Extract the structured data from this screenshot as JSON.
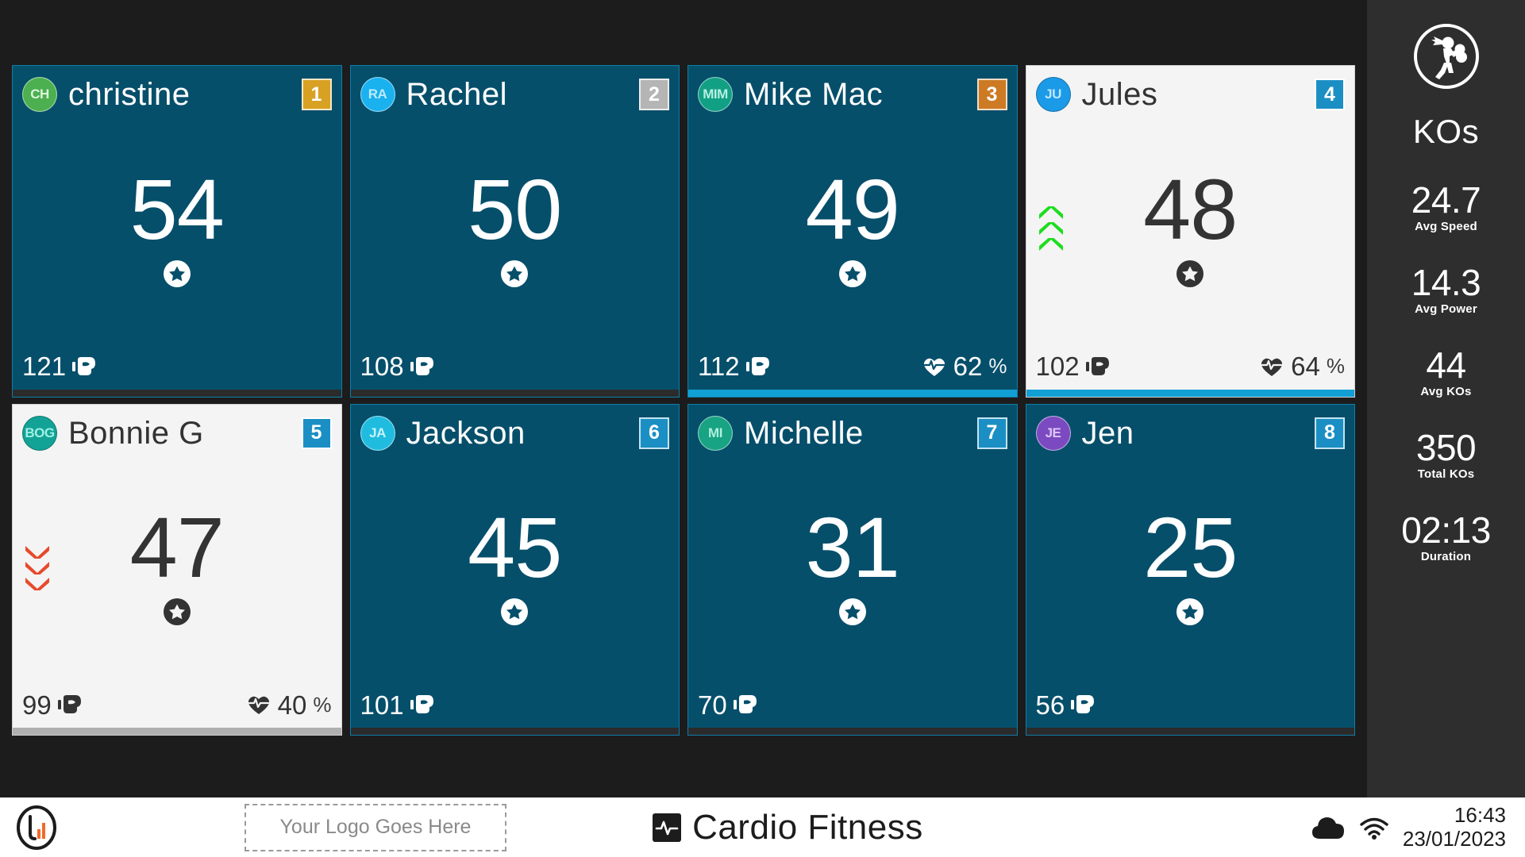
{
  "app": {
    "background": "#1c1c1c",
    "panel_background": "#2e2e2e",
    "card_background": "#064f6b",
    "card_light_background": "#f4f4f4"
  },
  "cards": [
    {
      "rank": "1",
      "name": "christine",
      "initials": "CH",
      "avatar_color": "#4caf50",
      "avatar_text_color": "#dcf7dd",
      "rank_color": "#d9a123",
      "score": "54",
      "punches": "121",
      "hr": "",
      "hr_unit": "%",
      "theme": "dark",
      "trend": "none",
      "accent_color": "#2b2b2b"
    },
    {
      "rank": "2",
      "name": "Rachel",
      "initials": "RA",
      "avatar_color": "#19b1ee",
      "avatar_text_color": "#bdeaff",
      "rank_color": "#b5b5b5",
      "score": "50",
      "punches": "108",
      "hr": "",
      "hr_unit": "%",
      "theme": "dark",
      "trend": "none",
      "accent_color": "#2b2b2b"
    },
    {
      "rank": "3",
      "name": "Mike Mac",
      "initials": "MIM",
      "avatar_color": "#12a085",
      "avatar_text_color": "#b6f0e2",
      "rank_color": "#cd7a24",
      "score": "49",
      "punches": "112",
      "hr": "62",
      "hr_unit": "%",
      "theme": "dark",
      "trend": "none",
      "accent_color": "#119fd4"
    },
    {
      "rank": "4",
      "name": "Jules",
      "initials": "JU",
      "avatar_color": "#1b9ae8",
      "avatar_text_color": "#bfe7ff",
      "rank_color": "#1b8fc4",
      "score": "48",
      "punches": "102",
      "hr": "64",
      "hr_unit": "%",
      "theme": "light",
      "trend": "up",
      "accent_color": "#119fd4"
    },
    {
      "rank": "5",
      "name": "Bonnie G",
      "initials": "BOG",
      "avatar_color": "#13a396",
      "avatar_text_color": "#9ff0e4",
      "rank_color": "#1b8fc4",
      "score": "47",
      "punches": "99",
      "hr": "40",
      "hr_unit": "%",
      "theme": "light",
      "trend": "down",
      "accent_color": "#b0b0b0"
    },
    {
      "rank": "6",
      "name": "Jackson",
      "initials": "JA",
      "avatar_color": "#1fbcdf",
      "avatar_text_color": "#c9f2fb",
      "rank_color": "#1b8fc4",
      "score": "45",
      "punches": "101",
      "hr": "",
      "hr_unit": "%",
      "theme": "dark",
      "trend": "none",
      "accent_color": "#2b2b2b"
    },
    {
      "rank": "7",
      "name": "Michelle",
      "initials": "MI",
      "avatar_color": "#18a383",
      "avatar_text_color": "#aeeedc",
      "rank_color": "#1b8fc4",
      "score": "31",
      "punches": "70",
      "hr": "",
      "hr_unit": "%",
      "theme": "dark",
      "trend": "none",
      "accent_color": "#2b2b2b"
    },
    {
      "rank": "8",
      "name": "Jen",
      "initials": "JE",
      "avatar_color": "#7b4ac0",
      "avatar_text_color": "#dcc6f7",
      "rank_color": "#1b8fc4",
      "score": "25",
      "punches": "56",
      "hr": "",
      "hr_unit": "%",
      "theme": "dark",
      "trend": "none",
      "accent_color": "#2b2b2b"
    }
  ],
  "side_panel": {
    "icon": "boxer-ring-icon",
    "title": "KOs",
    "stats": [
      {
        "value": "24.7",
        "label": "Avg Speed"
      },
      {
        "value": "14.3",
        "label": "Avg Power"
      },
      {
        "value": "44",
        "label": "Avg KOs"
      },
      {
        "value": "350",
        "label": "Total KOs"
      },
      {
        "value": "02:13",
        "label": "Duration"
      }
    ]
  },
  "bottom_bar": {
    "logo_icon": "app-logo-icon",
    "logo_slot_text": "Your Logo Goes Here",
    "brand_icon": "heartbeat-icon",
    "brand_name": "Cardio Fitness",
    "cloud_icon": "cloud-icon",
    "wifi_icon": "wifi-icon",
    "time": "16:43",
    "date": "23/01/2023"
  },
  "icons": {
    "glove": "boxing-glove-icon",
    "heart_rate": "heart-rate-icon",
    "star": "star-badge-icon",
    "chevron_up": "chevron-up-icon",
    "chevron_down": "chevron-down-icon"
  }
}
